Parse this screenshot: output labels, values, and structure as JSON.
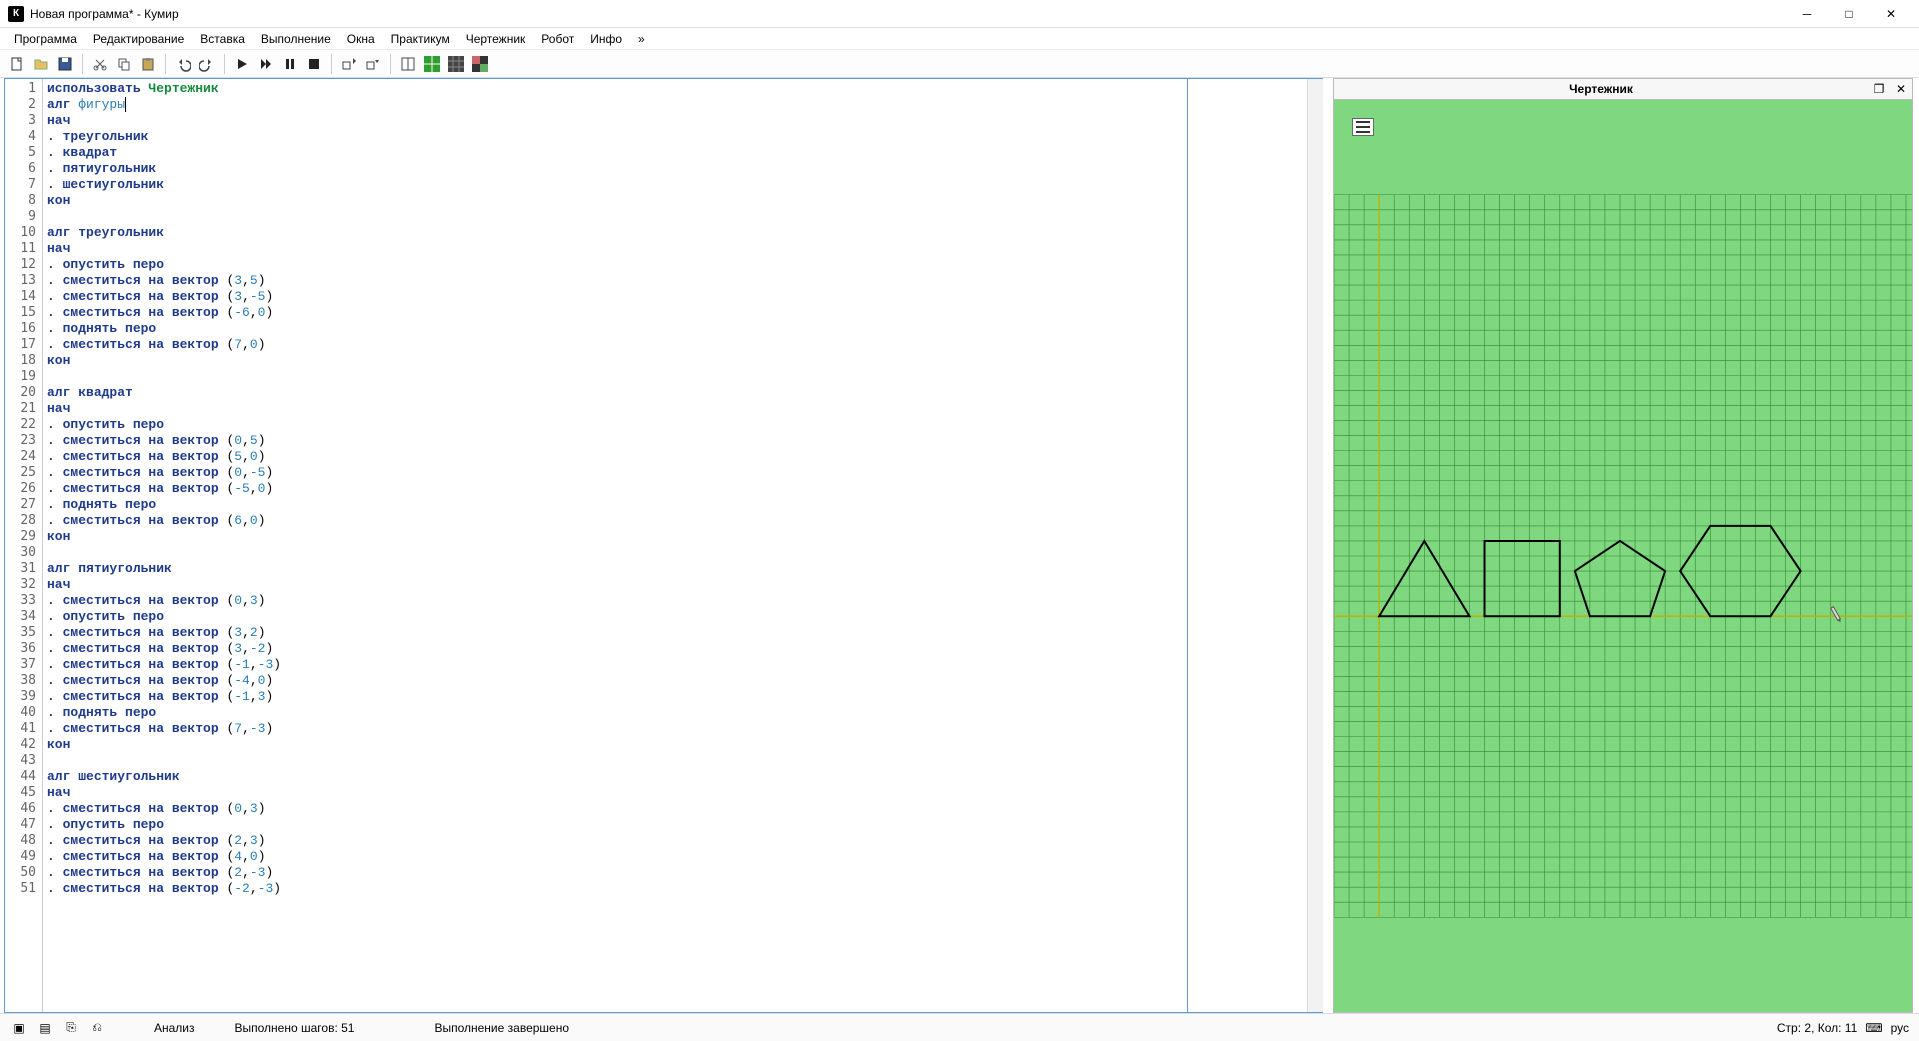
{
  "title": "Новая программа* - Кумир",
  "app_icon_letter": "К",
  "menu": [
    "Программа",
    "Редактирование",
    "Вставка",
    "Выполнение",
    "Окна",
    "Практикум",
    "Чертежник",
    "Робот",
    "Инфо",
    "»"
  ],
  "drawer": {
    "title": "Чертежник"
  },
  "status": {
    "analysis": "Анализ",
    "steps": "Выполнено шагов: 51",
    "done": "Выполнение завершено",
    "pos": "Стр: 2, Кол: 11",
    "lang": "рус"
  },
  "code": [
    {
      "n": 1,
      "tokens": [
        {
          "t": "использовать ",
          "c": "kw"
        },
        {
          "t": "Чертежник",
          "c": "imp"
        }
      ]
    },
    {
      "n": 2,
      "tokens": [
        {
          "t": "алг ",
          "c": "kw"
        },
        {
          "t": "фигуры",
          "c": "id cursor"
        }
      ]
    },
    {
      "n": 3,
      "tokens": [
        {
          "t": "нач",
          "c": "kw"
        }
      ]
    },
    {
      "n": 4,
      "tokens": [
        {
          "t": ". ",
          "c": ""
        },
        {
          "t": "треугольник",
          "c": "kw2"
        }
      ]
    },
    {
      "n": 5,
      "tokens": [
        {
          "t": ". ",
          "c": ""
        },
        {
          "t": "квадрат",
          "c": "kw2"
        }
      ]
    },
    {
      "n": 6,
      "tokens": [
        {
          "t": ". ",
          "c": ""
        },
        {
          "t": "пятиугольник",
          "c": "kw2"
        }
      ]
    },
    {
      "n": 7,
      "tokens": [
        {
          "t": ". ",
          "c": ""
        },
        {
          "t": "шестиугольник",
          "c": "kw2"
        }
      ]
    },
    {
      "n": 8,
      "tokens": [
        {
          "t": "кон",
          "c": "kw"
        }
      ]
    },
    {
      "n": 9,
      "tokens": [
        {
          "t": " ",
          "c": ""
        }
      ]
    },
    {
      "n": 10,
      "tokens": [
        {
          "t": "алг ",
          "c": "kw"
        },
        {
          "t": "треугольник",
          "c": "kw2"
        }
      ]
    },
    {
      "n": 11,
      "tokens": [
        {
          "t": "нач",
          "c": "kw"
        }
      ]
    },
    {
      "n": 12,
      "tokens": [
        {
          "t": ". ",
          "c": ""
        },
        {
          "t": "опустить перо",
          "c": "kw2"
        }
      ]
    },
    {
      "n": 13,
      "tokens": [
        {
          "t": ". ",
          "c": ""
        },
        {
          "t": "сместиться на вектор ",
          "c": "kw2"
        },
        {
          "t": "(",
          "c": ""
        },
        {
          "t": "3",
          "c": "num"
        },
        {
          "t": ",",
          "c": ""
        },
        {
          "t": "5",
          "c": "num"
        },
        {
          "t": ")",
          "c": ""
        }
      ]
    },
    {
      "n": 14,
      "tokens": [
        {
          "t": ". ",
          "c": ""
        },
        {
          "t": "сместиться на вектор ",
          "c": "kw2"
        },
        {
          "t": "(",
          "c": ""
        },
        {
          "t": "3",
          "c": "num"
        },
        {
          "t": ",",
          "c": ""
        },
        {
          "t": "-5",
          "c": "num"
        },
        {
          "t": ")",
          "c": ""
        }
      ]
    },
    {
      "n": 15,
      "tokens": [
        {
          "t": ". ",
          "c": ""
        },
        {
          "t": "сместиться на вектор ",
          "c": "kw2"
        },
        {
          "t": "(",
          "c": ""
        },
        {
          "t": "-6",
          "c": "num"
        },
        {
          "t": ",",
          "c": ""
        },
        {
          "t": "0",
          "c": "num"
        },
        {
          "t": ")",
          "c": ""
        }
      ]
    },
    {
      "n": 16,
      "tokens": [
        {
          "t": ". ",
          "c": ""
        },
        {
          "t": "поднять перо",
          "c": "kw2"
        }
      ]
    },
    {
      "n": 17,
      "tokens": [
        {
          "t": ". ",
          "c": ""
        },
        {
          "t": "сместиться на вектор ",
          "c": "kw2"
        },
        {
          "t": "(",
          "c": ""
        },
        {
          "t": "7",
          "c": "num"
        },
        {
          "t": ",",
          "c": ""
        },
        {
          "t": "0",
          "c": "num"
        },
        {
          "t": ")",
          "c": ""
        }
      ]
    },
    {
      "n": 18,
      "tokens": [
        {
          "t": "кон",
          "c": "kw"
        }
      ]
    },
    {
      "n": 19,
      "tokens": [
        {
          "t": " ",
          "c": ""
        }
      ]
    },
    {
      "n": 20,
      "tokens": [
        {
          "t": "алг ",
          "c": "kw"
        },
        {
          "t": "квадрат",
          "c": "kw2"
        }
      ]
    },
    {
      "n": 21,
      "tokens": [
        {
          "t": "нач",
          "c": "kw"
        }
      ]
    },
    {
      "n": 22,
      "tokens": [
        {
          "t": ". ",
          "c": ""
        },
        {
          "t": "опустить перо",
          "c": "kw2"
        }
      ]
    },
    {
      "n": 23,
      "tokens": [
        {
          "t": ". ",
          "c": ""
        },
        {
          "t": "сместиться на вектор ",
          "c": "kw2"
        },
        {
          "t": "(",
          "c": ""
        },
        {
          "t": "0",
          "c": "num"
        },
        {
          "t": ",",
          "c": ""
        },
        {
          "t": "5",
          "c": "num"
        },
        {
          "t": ")",
          "c": ""
        }
      ]
    },
    {
      "n": 24,
      "tokens": [
        {
          "t": ". ",
          "c": ""
        },
        {
          "t": "сместиться на вектор ",
          "c": "kw2"
        },
        {
          "t": "(",
          "c": ""
        },
        {
          "t": "5",
          "c": "num"
        },
        {
          "t": ",",
          "c": ""
        },
        {
          "t": "0",
          "c": "num"
        },
        {
          "t": ")",
          "c": ""
        }
      ]
    },
    {
      "n": 25,
      "tokens": [
        {
          "t": ". ",
          "c": ""
        },
        {
          "t": "сместиться на вектор ",
          "c": "kw2"
        },
        {
          "t": "(",
          "c": ""
        },
        {
          "t": "0",
          "c": "num"
        },
        {
          "t": ",",
          "c": ""
        },
        {
          "t": "-5",
          "c": "num"
        },
        {
          "t": ")",
          "c": ""
        }
      ]
    },
    {
      "n": 26,
      "tokens": [
        {
          "t": ". ",
          "c": ""
        },
        {
          "t": "сместиться на вектор ",
          "c": "kw2"
        },
        {
          "t": "(",
          "c": ""
        },
        {
          "t": "-5",
          "c": "num"
        },
        {
          "t": ",",
          "c": ""
        },
        {
          "t": "0",
          "c": "num"
        },
        {
          "t": ")",
          "c": ""
        }
      ]
    },
    {
      "n": 27,
      "tokens": [
        {
          "t": ". ",
          "c": ""
        },
        {
          "t": "поднять перо",
          "c": "kw2"
        }
      ]
    },
    {
      "n": 28,
      "tokens": [
        {
          "t": ". ",
          "c": ""
        },
        {
          "t": "сместиться на вектор ",
          "c": "kw2"
        },
        {
          "t": "(",
          "c": ""
        },
        {
          "t": "6",
          "c": "num"
        },
        {
          "t": ",",
          "c": ""
        },
        {
          "t": "0",
          "c": "num"
        },
        {
          "t": ")",
          "c": ""
        }
      ]
    },
    {
      "n": 29,
      "tokens": [
        {
          "t": "кон",
          "c": "kw"
        }
      ]
    },
    {
      "n": 30,
      "tokens": [
        {
          "t": " ",
          "c": ""
        }
      ]
    },
    {
      "n": 31,
      "tokens": [
        {
          "t": "алг ",
          "c": "kw"
        },
        {
          "t": "пятиугольник",
          "c": "kw2"
        }
      ]
    },
    {
      "n": 32,
      "tokens": [
        {
          "t": "нач",
          "c": "kw"
        }
      ]
    },
    {
      "n": 33,
      "tokens": [
        {
          "t": ". ",
          "c": ""
        },
        {
          "t": "сместиться на вектор ",
          "c": "kw2"
        },
        {
          "t": "(",
          "c": ""
        },
        {
          "t": "0",
          "c": "num"
        },
        {
          "t": ",",
          "c": ""
        },
        {
          "t": "3",
          "c": "num"
        },
        {
          "t": ")",
          "c": ""
        }
      ]
    },
    {
      "n": 34,
      "tokens": [
        {
          "t": ". ",
          "c": ""
        },
        {
          "t": "опустить перо",
          "c": "kw2"
        }
      ]
    },
    {
      "n": 35,
      "tokens": [
        {
          "t": ". ",
          "c": ""
        },
        {
          "t": "сместиться на вектор ",
          "c": "kw2"
        },
        {
          "t": "(",
          "c": ""
        },
        {
          "t": "3",
          "c": "num"
        },
        {
          "t": ",",
          "c": ""
        },
        {
          "t": "2",
          "c": "num"
        },
        {
          "t": ")",
          "c": ""
        }
      ]
    },
    {
      "n": 36,
      "tokens": [
        {
          "t": ". ",
          "c": ""
        },
        {
          "t": "сместиться на вектор ",
          "c": "kw2"
        },
        {
          "t": "(",
          "c": ""
        },
        {
          "t": "3",
          "c": "num"
        },
        {
          "t": ",",
          "c": ""
        },
        {
          "t": "-2",
          "c": "num"
        },
        {
          "t": ")",
          "c": ""
        }
      ]
    },
    {
      "n": 37,
      "tokens": [
        {
          "t": ". ",
          "c": ""
        },
        {
          "t": "сместиться на вектор ",
          "c": "kw2"
        },
        {
          "t": "(",
          "c": ""
        },
        {
          "t": "-1",
          "c": "num"
        },
        {
          "t": ",",
          "c": ""
        },
        {
          "t": "-3",
          "c": "num"
        },
        {
          "t": ")",
          "c": ""
        }
      ]
    },
    {
      "n": 38,
      "tokens": [
        {
          "t": ". ",
          "c": ""
        },
        {
          "t": "сместиться на вектор ",
          "c": "kw2"
        },
        {
          "t": "(",
          "c": ""
        },
        {
          "t": "-4",
          "c": "num"
        },
        {
          "t": ",",
          "c": ""
        },
        {
          "t": "0",
          "c": "num"
        },
        {
          "t": ")",
          "c": ""
        }
      ]
    },
    {
      "n": 39,
      "tokens": [
        {
          "t": ". ",
          "c": ""
        },
        {
          "t": "сместиться на вектор ",
          "c": "kw2"
        },
        {
          "t": "(",
          "c": ""
        },
        {
          "t": "-1",
          "c": "num"
        },
        {
          "t": ",",
          "c": ""
        },
        {
          "t": "3",
          "c": "num"
        },
        {
          "t": ")",
          "c": ""
        }
      ]
    },
    {
      "n": 40,
      "tokens": [
        {
          "t": ". ",
          "c": ""
        },
        {
          "t": "поднять перо",
          "c": "kw2"
        }
      ]
    },
    {
      "n": 41,
      "tokens": [
        {
          "t": ". ",
          "c": ""
        },
        {
          "t": "сместиться на вектор ",
          "c": "kw2"
        },
        {
          "t": "(",
          "c": ""
        },
        {
          "t": "7",
          "c": "num"
        },
        {
          "t": ",",
          "c": ""
        },
        {
          "t": "-3",
          "c": "num"
        },
        {
          "t": ")",
          "c": ""
        }
      ]
    },
    {
      "n": 42,
      "tokens": [
        {
          "t": "кон",
          "c": "kw"
        }
      ]
    },
    {
      "n": 43,
      "tokens": [
        {
          "t": " ",
          "c": ""
        }
      ]
    },
    {
      "n": 44,
      "tokens": [
        {
          "t": "алг ",
          "c": "kw"
        },
        {
          "t": "шестиугольник",
          "c": "kw2"
        }
      ]
    },
    {
      "n": 45,
      "tokens": [
        {
          "t": "нач",
          "c": "kw"
        }
      ]
    },
    {
      "n": 46,
      "tokens": [
        {
          "t": ". ",
          "c": ""
        },
        {
          "t": "сместиться на вектор ",
          "c": "kw2"
        },
        {
          "t": "(",
          "c": ""
        },
        {
          "t": "0",
          "c": "num"
        },
        {
          "t": ",",
          "c": ""
        },
        {
          "t": "3",
          "c": "num"
        },
        {
          "t": ")",
          "c": ""
        }
      ]
    },
    {
      "n": 47,
      "tokens": [
        {
          "t": ". ",
          "c": ""
        },
        {
          "t": "опустить перо",
          "c": "kw2"
        }
      ]
    },
    {
      "n": 48,
      "tokens": [
        {
          "t": ". ",
          "c": ""
        },
        {
          "t": "сместиться на вектор ",
          "c": "kw2"
        },
        {
          "t": "(",
          "c": ""
        },
        {
          "t": "2",
          "c": "num"
        },
        {
          "t": ",",
          "c": ""
        },
        {
          "t": "3",
          "c": "num"
        },
        {
          "t": ")",
          "c": ""
        }
      ]
    },
    {
      "n": 49,
      "tokens": [
        {
          "t": ". ",
          "c": ""
        },
        {
          "t": "сместиться на вектор ",
          "c": "kw2"
        },
        {
          "t": "(",
          "c": ""
        },
        {
          "t": "4",
          "c": "num"
        },
        {
          "t": ",",
          "c": ""
        },
        {
          "t": "0",
          "c": "num"
        },
        {
          "t": ")",
          "c": ""
        }
      ]
    },
    {
      "n": 50,
      "tokens": [
        {
          "t": ". ",
          "c": ""
        },
        {
          "t": "сместиться на вектор ",
          "c": "kw2"
        },
        {
          "t": "(",
          "c": ""
        },
        {
          "t": "2",
          "c": "num"
        },
        {
          "t": ",",
          "c": ""
        },
        {
          "t": "-3",
          "c": "num"
        },
        {
          "t": ")",
          "c": ""
        }
      ]
    },
    {
      "n": 51,
      "tokens": [
        {
          "t": ". ",
          "c": ""
        },
        {
          "t": "сместиться на вектор ",
          "c": "kw2"
        },
        {
          "t": "(",
          "c": ""
        },
        {
          "t": "-2",
          "c": "num"
        },
        {
          "t": ",",
          "c": ""
        },
        {
          "t": "-3",
          "c": "num"
        },
        {
          "t": ")",
          "c": ""
        }
      ]
    }
  ],
  "toolbar_icons": [
    "new-file",
    "open-file",
    "save-file",
    "sep",
    "cut",
    "copy",
    "paste",
    "sep",
    "undo",
    "redo",
    "sep",
    "run",
    "run-fast",
    "pause",
    "stop",
    "sep",
    "step-into",
    "step-over",
    "sep",
    "split-view",
    "grid-green",
    "grid-dark",
    "checker"
  ],
  "colors": {
    "canvas_bg": "#7fd87f",
    "grid_line": "#2c8c2c",
    "axis_line": "#c0b000"
  }
}
